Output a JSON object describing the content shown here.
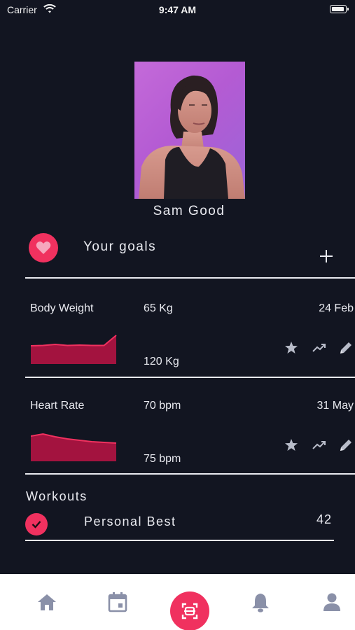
{
  "status_bar": {
    "carrier": "Carrier",
    "time": "9:47 AM"
  },
  "profile": {
    "name": "Sam Good"
  },
  "goals": {
    "title": "Your goals",
    "add_icon": "plus-icon",
    "header_icon": "heart-icon"
  },
  "metrics": [
    {
      "name": "Body Weight",
      "current": "65 Kg",
      "date": "24 Feb",
      "target": "120 Kg",
      "trend": [
        0.48,
        0.47,
        0.44,
        0.47,
        0.46,
        0.47,
        0.47,
        0.18
      ]
    },
    {
      "name": "Heart Rate",
      "current": "70 bpm",
      "date": "31 May",
      "target": "75 bpm",
      "trend": [
        0.28,
        0.22,
        0.3,
        0.36,
        0.4,
        0.44,
        0.46,
        0.48
      ]
    }
  ],
  "workouts": {
    "title": "Workouts",
    "item_label": "Personal Best",
    "item_value": "42",
    "item_icon": "check-icon"
  },
  "tab_bar": {
    "tabs": [
      "home-icon",
      "calendar-icon",
      "scan-icon",
      "bell-icon",
      "profile-icon"
    ]
  },
  "colors": {
    "background": "#121521",
    "accent": "#f0315f",
    "chart_fill": "#a3133f",
    "tab_icon": "#8a90a8"
  }
}
